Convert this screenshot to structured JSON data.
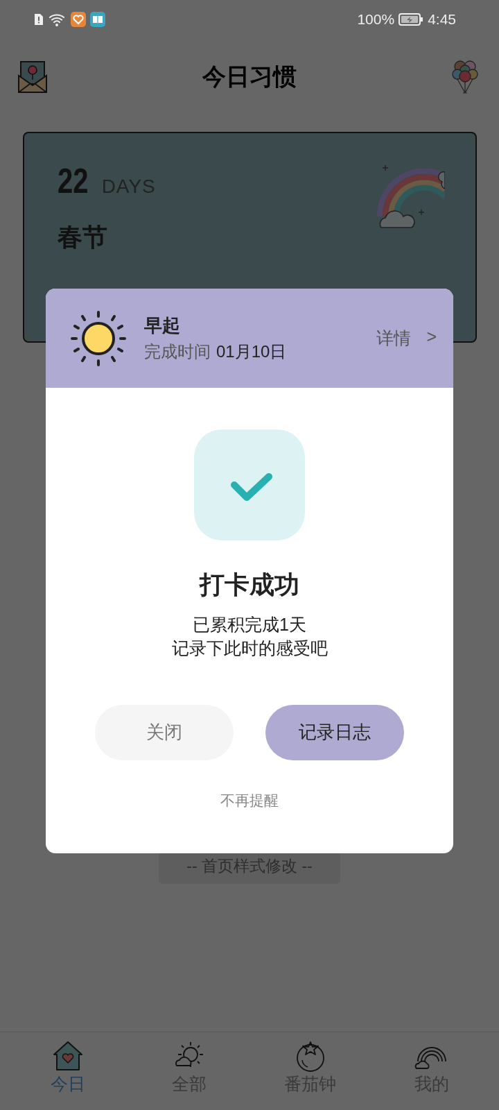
{
  "status_bar": {
    "battery": "100%",
    "time": "4:45"
  },
  "header": {
    "title": "今日习惯"
  },
  "card": {
    "count": "22",
    "unit": "DAYS",
    "name": "春节"
  },
  "footer_link": "-- 首页样式修改 --",
  "dialog": {
    "habit": "早起",
    "time_label": "完成时间",
    "time_value": "01月10日",
    "details": "详情",
    "details_arrow": ">",
    "title": "打卡成功",
    "lines": [
      "已累积完成1天",
      "记录下此时的感受吧"
    ],
    "buttons": [
      {
        "label": "关闭",
        "kind": "secondary"
      },
      {
        "label": "记录日志",
        "kind": "primary"
      }
    ],
    "dismiss": "不再提醒"
  },
  "tabs": [
    {
      "label": "今日",
      "selected": true,
      "kind": "home"
    },
    {
      "label": "全部",
      "selected": false,
      "kind": "weather"
    },
    {
      "label": "番茄钟",
      "selected": false,
      "kind": "tomato"
    },
    {
      "label": "我的",
      "selected": false,
      "kind": "rainbow"
    }
  ]
}
